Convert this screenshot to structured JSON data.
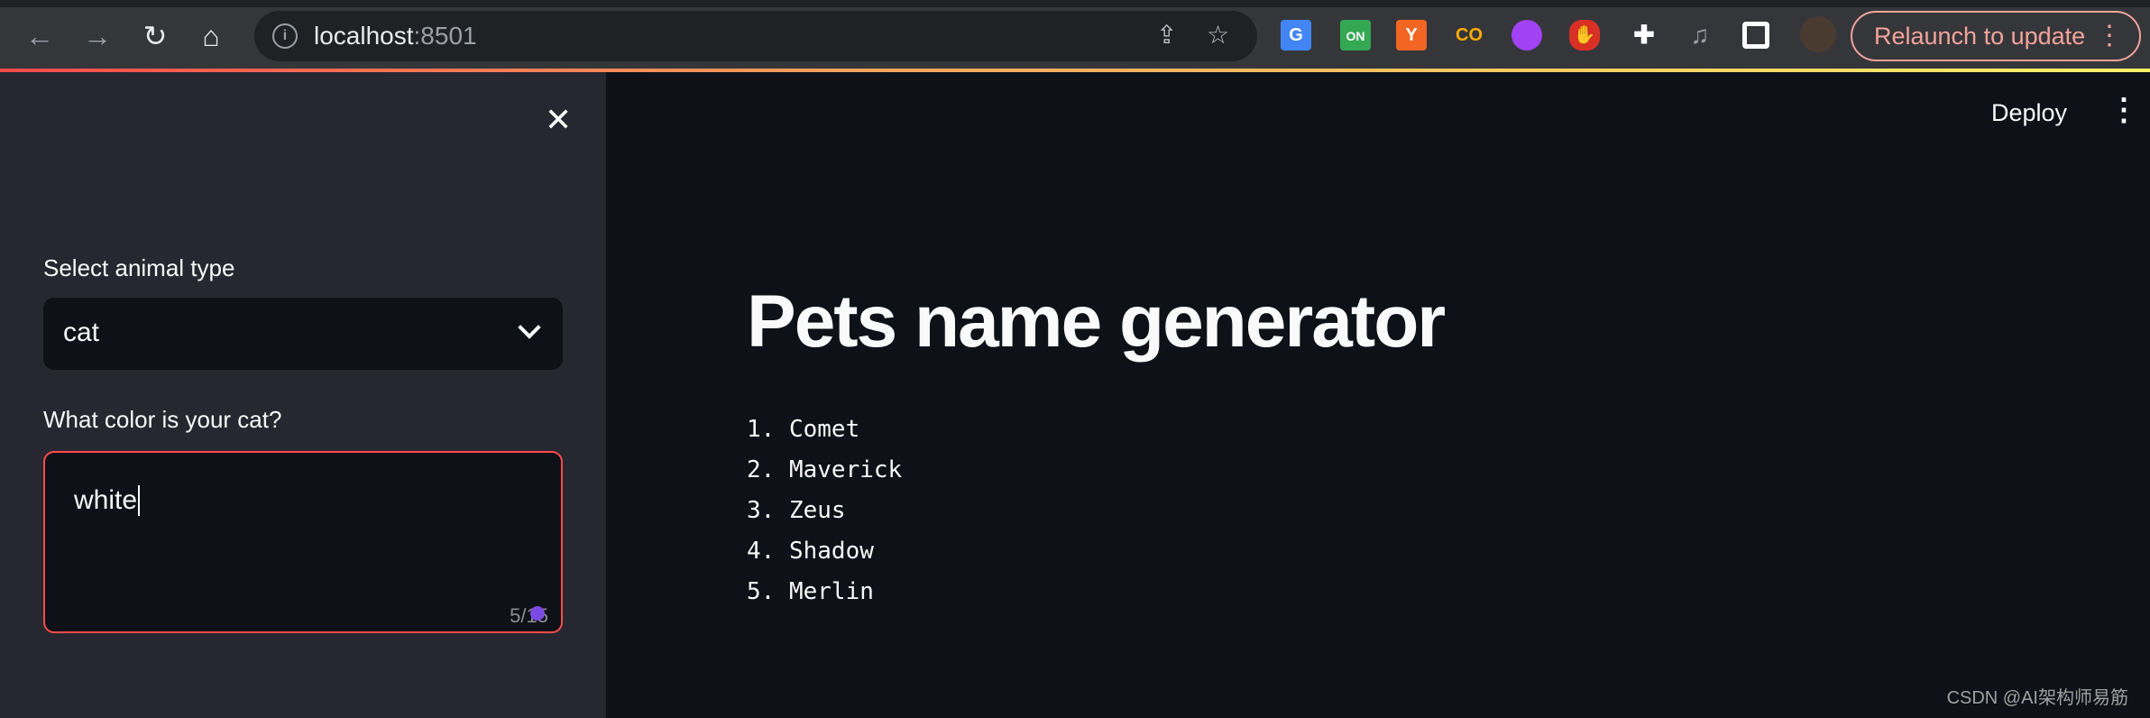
{
  "browser": {
    "url_host": "localhost",
    "url_port": ":8501",
    "relaunch_label": "Relaunch to update",
    "extensions": [
      "google-translate",
      "on-extension",
      "y-combinator",
      "colab",
      "brain",
      "adblock",
      "puzzle",
      "media",
      "sidepanel",
      "profile-avatar"
    ],
    "ext_on_label": "ON",
    "ext_y_label": "Y",
    "ext_co_label": "CO"
  },
  "sidebar": {
    "select_label": "Select animal type",
    "select_value": "cat",
    "textarea_label": "What color is your cat?",
    "textarea_value": "white",
    "char_counter": "5/15"
  },
  "header": {
    "deploy_label": "Deploy"
  },
  "main": {
    "title": "Pets name generator",
    "names": [
      "1. Comet",
      "2. Maverick",
      "3. Zeus",
      "4. Shadow",
      "5. Merlin"
    ]
  },
  "watermark": "CSDN @AI架构师易筋",
  "colors": {
    "accent": "#ff4b4b",
    "sidebar_bg": "#262730",
    "main_bg": "#0e1117"
  }
}
